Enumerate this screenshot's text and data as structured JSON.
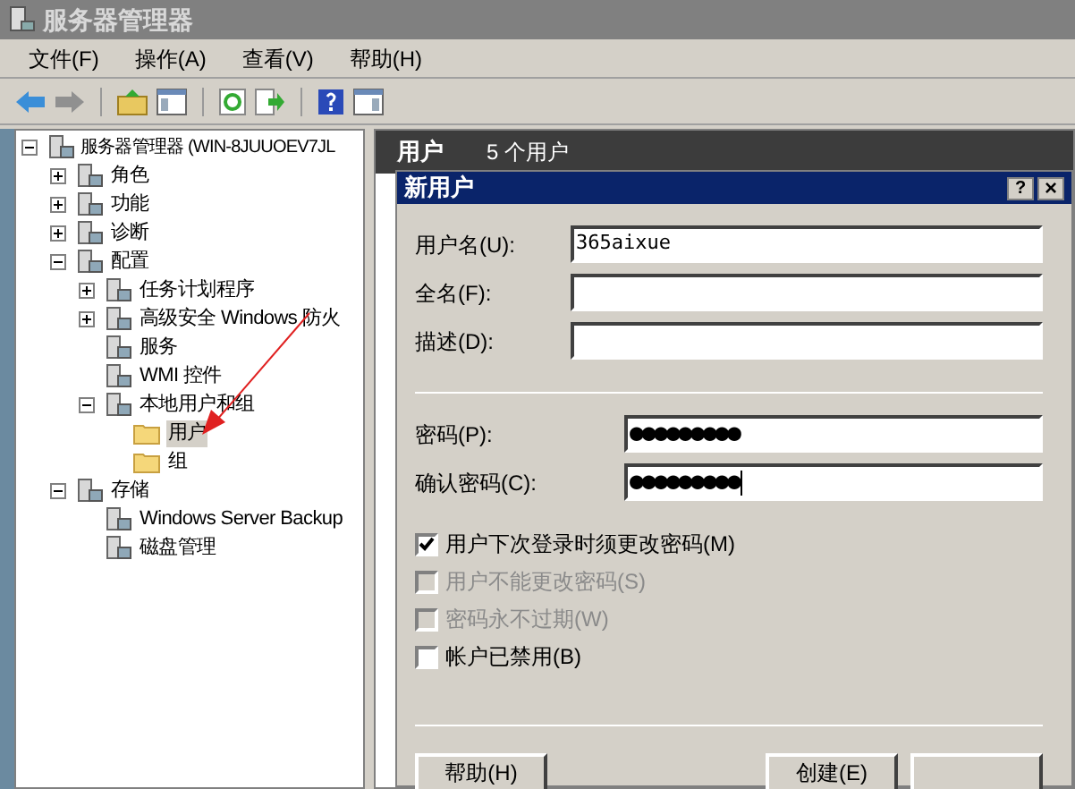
{
  "window": {
    "title": "服务器管理器"
  },
  "menu": [
    "文件(F)",
    "操作(A)",
    "查看(V)",
    "帮助(H)"
  ],
  "tree": [
    {
      "label": "服务器管理器 (WIN-8JUUOEV7JL",
      "kind": "node",
      "expanded": true,
      "children": [
        {
          "label": "角色",
          "kind": "node",
          "expanded": false
        },
        {
          "label": "功能",
          "kind": "node",
          "expanded": false
        },
        {
          "label": "诊断",
          "kind": "node",
          "expanded": false
        },
        {
          "label": "配置",
          "kind": "node",
          "expanded": true,
          "children": [
            {
              "label": "任务计划程序",
              "kind": "node",
              "expanded": false
            },
            {
              "label": "高级安全 Windows 防火",
              "kind": "node",
              "expanded": false
            },
            {
              "label": "服务",
              "kind": "node"
            },
            {
              "label": "WMI 控件",
              "kind": "node"
            },
            {
              "label": "本地用户和组",
              "kind": "node",
              "expanded": true,
              "children": [
                {
                  "label": "用户",
                  "kind": "folder",
                  "selected": true
                },
                {
                  "label": "组",
                  "kind": "folder",
                  "selected": false
                }
              ]
            }
          ]
        },
        {
          "label": "存储",
          "kind": "node",
          "expanded": true,
          "children": [
            {
              "label": "Windows Server Backup",
              "kind": "node"
            },
            {
              "label": "磁盘管理",
              "kind": "node"
            }
          ]
        }
      ]
    }
  ],
  "pane_header": {
    "title": "用户",
    "count": "5 个用户"
  },
  "dialog": {
    "title": "新用户",
    "help_glyph": "?",
    "close_glyph": "×",
    "fields": [
      {
        "label": "用户名(U):",
        "value": "365aixue",
        "kind": "text"
      },
      {
        "label": "全名(F):",
        "kind": "text"
      },
      {
        "label": "描述(D):",
        "kind": "text"
      },
      {
        "label": "密码(P):",
        "value": "●●●●●●●●●",
        "kind": "password"
      },
      {
        "label": "确认密码(C):",
        "value": "●●●●●●●●●",
        "kind": "password",
        "focused": true
      }
    ],
    "checkboxes": [
      {
        "label": "用户下次登录时须更改密码(M)",
        "checked": true,
        "disabled": false
      },
      {
        "label": "用户不能更改密码(S)",
        "checked": false,
        "disabled": true
      },
      {
        "label": "密码永不过期(W)",
        "checked": false,
        "disabled": true
      },
      {
        "label": "帐户已禁用(B)",
        "checked": false,
        "disabled": false
      }
    ],
    "buttons": [
      {
        "label": "帮助(H)",
        "kind": "push"
      },
      {
        "label": "创建(E)",
        "kind": "push"
      },
      {
        "kind": "push"
      }
    ]
  }
}
